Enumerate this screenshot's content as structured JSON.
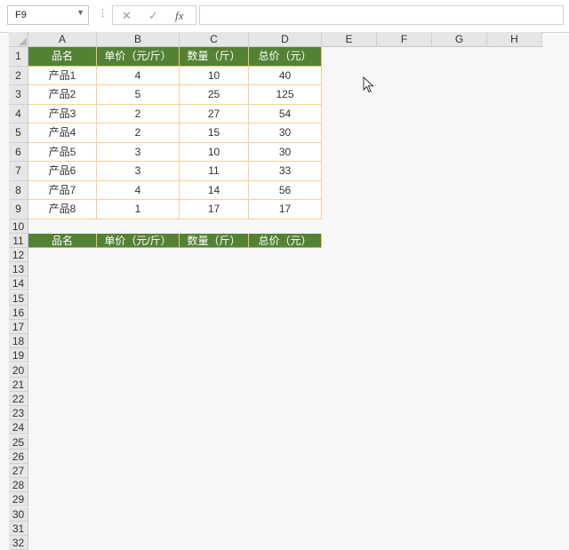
{
  "formula_bar": {
    "name_box": "F9",
    "name_box_icon": "chevron-down-icon",
    "more_icon": "vertical-dots-icon",
    "cancel_icon": "close-icon",
    "enter_icon": "check-icon",
    "function_label": "fx",
    "formula_value": ""
  },
  "columns": [
    "A",
    "B",
    "C",
    "D",
    "E",
    "F",
    "G",
    "H"
  ],
  "rows": [
    "1",
    "2",
    "3",
    "4",
    "5",
    "6",
    "7",
    "8",
    "9",
    "10",
    "11",
    "12",
    "13",
    "14",
    "15",
    "16",
    "17",
    "18",
    "19",
    "20",
    "21",
    "22",
    "23",
    "24",
    "25",
    "26",
    "27",
    "28",
    "29",
    "30",
    "31",
    "32"
  ],
  "table1": {
    "headers": [
      "品名",
      "单价（元/斤）",
      "数量（斤）",
      "总价（元）"
    ],
    "rows": [
      [
        "产品1",
        "4",
        "10",
        "40"
      ],
      [
        "产品2",
        "5",
        "25",
        "125"
      ],
      [
        "产品3",
        "2",
        "27",
        "54"
      ],
      [
        "产品4",
        "2",
        "15",
        "30"
      ],
      [
        "产品5",
        "3",
        "10",
        "30"
      ],
      [
        "产品6",
        "3",
        "11",
        "33"
      ],
      [
        "产品7",
        "4",
        "14",
        "56"
      ],
      [
        "产品8",
        "1",
        "17",
        "17"
      ]
    ]
  },
  "table2": {
    "headers": [
      "品名",
      "单价（元/斤）",
      "数量（斤）",
      "总价（元）"
    ]
  },
  "colors": {
    "header_fill": "#548235",
    "header_text": "#ffffff",
    "border": "#f5cf9c"
  }
}
